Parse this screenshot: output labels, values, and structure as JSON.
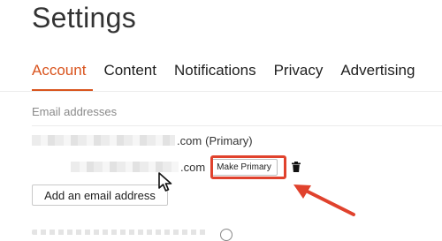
{
  "page": {
    "title": "Settings"
  },
  "tabs": [
    {
      "label": "Account",
      "active": true
    },
    {
      "label": "Content",
      "active": false
    },
    {
      "label": "Notifications",
      "active": false
    },
    {
      "label": "Privacy",
      "active": false
    },
    {
      "label": "Advertising",
      "active": false
    }
  ],
  "email_section": {
    "label": "Email addresses",
    "primary": {
      "domain_suffix": ".com",
      "status": "(Primary)"
    },
    "secondary": {
      "domain_suffix": ".com",
      "make_primary_label": "Make Primary",
      "delete_icon": "trash-icon"
    },
    "add_label": "Add an email address"
  },
  "colors": {
    "accent": "#d9541e",
    "annotation": "#e0422d"
  }
}
